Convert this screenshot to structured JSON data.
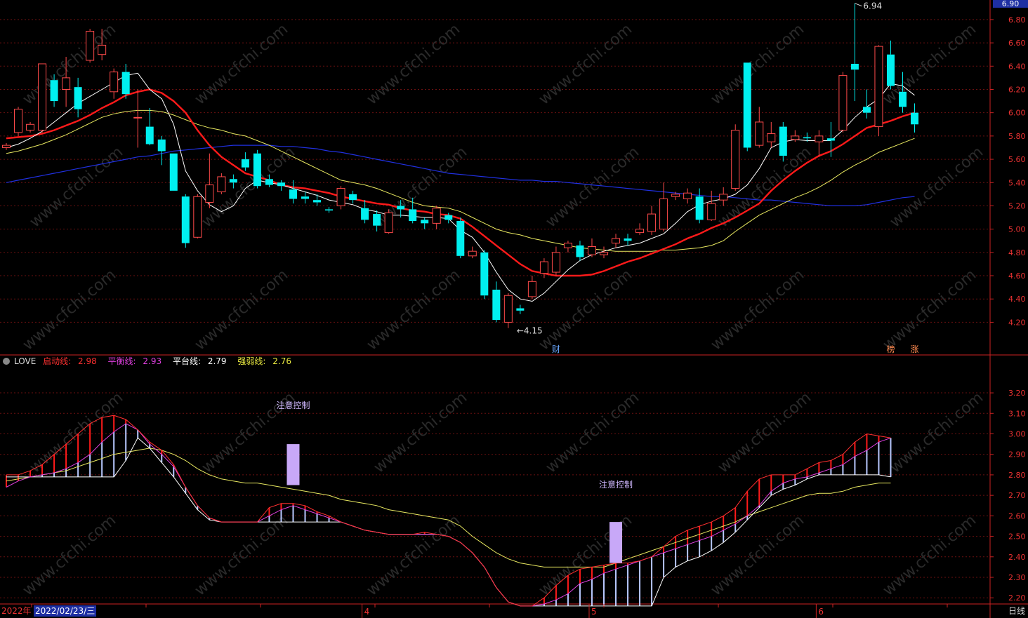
{
  "chart_data": [
    {
      "type": "candlestick",
      "price_axis": {
        "ylim": [
          4.1,
          6.92
        ],
        "ticks": [
          "6.80",
          "6.60",
          "6.40",
          "6.20",
          "6.00",
          "5.80",
          "5.60",
          "5.40",
          "5.20",
          "5.00",
          "4.80",
          "4.60",
          "4.40",
          "4.20"
        ]
      },
      "current_price_tag": "6.90",
      "high_annotation": "6.94",
      "low_annotation": "4.15",
      "markers": [
        {
          "label": "财",
          "index": 46
        },
        {
          "label": "榜",
          "index": 74
        },
        {
          "label": "涨",
          "index": 76
        }
      ],
      "candles": [
        [
          5.7,
          5.72,
          5.68,
          5.74
        ],
        [
          5.83,
          6.03,
          5.8,
          6.05
        ],
        [
          5.85,
          5.9,
          5.83,
          5.92
        ],
        [
          5.85,
          6.42,
          5.83,
          6.42
        ],
        [
          6.28,
          6.1,
          6.05,
          6.33
        ],
        [
          6.2,
          6.3,
          6.05,
          6.48
        ],
        [
          6.22,
          6.03,
          5.96,
          6.3
        ],
        [
          6.45,
          6.7,
          6.43,
          6.72
        ],
        [
          6.5,
          6.58,
          6.45,
          6.72
        ],
        [
          6.18,
          6.35,
          6.12,
          6.38
        ],
        [
          6.35,
          6.16,
          6.12,
          6.42
        ],
        [
          5.96,
          5.96,
          5.7,
          6.2
        ],
        [
          5.88,
          5.73,
          5.72,
          6.04
        ],
        [
          5.77,
          5.67,
          5.55,
          5.8
        ],
        [
          5.65,
          5.33,
          5.33,
          5.65
        ],
        [
          5.28,
          4.88,
          4.84,
          5.3
        ],
        [
          4.93,
          5.28,
          4.92,
          5.3
        ],
        [
          5.23,
          5.38,
          5.18,
          5.65
        ],
        [
          5.32,
          5.45,
          5.3,
          5.48
        ],
        [
          5.43,
          5.4,
          5.35,
          5.47
        ],
        [
          5.6,
          5.53,
          5.5,
          5.66
        ],
        [
          5.65,
          5.37,
          5.35,
          5.68
        ],
        [
          5.43,
          5.38,
          5.36,
          5.47
        ],
        [
          5.4,
          5.37,
          5.33,
          5.42
        ],
        [
          5.34,
          5.26,
          5.22,
          5.42
        ],
        [
          5.28,
          5.26,
          5.22,
          5.32
        ],
        [
          5.25,
          5.23,
          5.2,
          5.3
        ],
        [
          5.17,
          5.16,
          5.14,
          5.19
        ],
        [
          5.2,
          5.35,
          5.17,
          5.37
        ],
        [
          5.3,
          5.25,
          5.22,
          5.33
        ],
        [
          5.18,
          5.08,
          5.05,
          5.25
        ],
        [
          5.13,
          5.03,
          4.98,
          5.16
        ],
        [
          4.97,
          5.14,
          4.96,
          5.17
        ],
        [
          5.2,
          5.17,
          5.1,
          5.25
        ],
        [
          5.17,
          5.07,
          5.05,
          5.27
        ],
        [
          5.08,
          5.05,
          5.0,
          5.1
        ],
        [
          5.05,
          5.18,
          5.0,
          5.2
        ],
        [
          5.12,
          5.08,
          5.05,
          5.14
        ],
        [
          5.07,
          4.77,
          4.75,
          5.1
        ],
        [
          4.77,
          4.81,
          4.75,
          4.85
        ],
        [
          4.8,
          4.43,
          4.4,
          4.82
        ],
        [
          4.48,
          4.22,
          4.2,
          4.55
        ],
        [
          4.2,
          4.43,
          4.15,
          4.45
        ],
        [
          4.32,
          4.3,
          4.27,
          4.35
        ],
        [
          4.42,
          4.55,
          4.4,
          4.6
        ],
        [
          4.62,
          4.72,
          4.58,
          4.75
        ],
        [
          4.63,
          4.8,
          4.6,
          4.85
        ],
        [
          4.84,
          4.88,
          4.8,
          4.9
        ],
        [
          4.86,
          4.76,
          4.73,
          4.9
        ],
        [
          4.78,
          4.85,
          4.76,
          4.92
        ],
        [
          4.78,
          4.8,
          4.75,
          4.85
        ],
        [
          4.88,
          4.92,
          4.84,
          4.96
        ],
        [
          4.92,
          4.9,
          4.86,
          4.96
        ],
        [
          4.97,
          5.0,
          4.95,
          5.05
        ],
        [
          4.98,
          5.13,
          4.95,
          5.2
        ],
        [
          5.0,
          5.26,
          4.98,
          5.4
        ],
        [
          5.28,
          5.3,
          5.25,
          5.32
        ],
        [
          5.26,
          5.31,
          5.22,
          5.35
        ],
        [
          5.28,
          5.08,
          5.05,
          5.35
        ],
        [
          5.08,
          5.22,
          5.07,
          5.33
        ],
        [
          5.25,
          5.3,
          5.2,
          5.36
        ],
        [
          5.35,
          5.85,
          5.33,
          5.9
        ],
        [
          6.43,
          5.7,
          5.67,
          6.43
        ],
        [
          5.72,
          5.92,
          5.7,
          6.05
        ],
        [
          5.75,
          5.82,
          5.7,
          5.92
        ],
        [
          5.88,
          5.63,
          5.58,
          5.92
        ],
        [
          5.77,
          5.8,
          5.75,
          5.85
        ],
        [
          5.79,
          5.78,
          5.75,
          5.83
        ],
        [
          5.75,
          5.8,
          5.62,
          5.85
        ],
        [
          5.78,
          5.76,
          5.62,
          5.92
        ],
        [
          5.85,
          6.32,
          5.83,
          6.35
        ],
        [
          6.42,
          6.37,
          6.1,
          6.94
        ],
        [
          6.05,
          6.0,
          5.95,
          6.2
        ],
        [
          5.88,
          6.57,
          5.8,
          6.58
        ],
        [
          6.5,
          6.23,
          6.2,
          6.62
        ],
        [
          6.18,
          6.05,
          6.0,
          6.35
        ],
        [
          6.0,
          5.9,
          5.83,
          6.08
        ]
      ],
      "ma5": [
        5.7,
        5.73,
        5.78,
        5.84,
        5.92,
        6.0,
        6.08,
        6.14,
        6.2,
        6.26,
        6.32,
        6.34,
        6.2,
        6.12,
        5.9,
        5.5,
        5.33,
        5.21,
        5.15,
        5.2,
        5.35,
        5.42,
        5.4,
        5.38,
        5.35,
        5.32,
        5.29,
        5.25,
        5.23,
        5.21,
        5.17,
        5.15,
        5.12,
        5.12,
        5.11,
        5.1,
        5.1,
        5.09,
        4.99,
        4.93,
        4.8,
        4.63,
        4.48,
        4.4,
        4.38,
        4.45,
        4.55,
        4.65,
        4.73,
        4.78,
        4.81,
        4.84,
        4.86,
        4.88,
        4.92,
        4.96,
        5.05,
        5.15,
        5.21,
        5.24,
        5.26,
        5.3,
        5.38,
        5.52,
        5.7,
        5.75,
        5.77,
        5.76,
        5.76,
        5.76,
        5.85,
        5.96,
        6.05,
        6.12,
        6.25,
        6.23,
        6.15
      ],
      "ma10": [
        5.78,
        5.79,
        5.8,
        5.82,
        5.85,
        5.89,
        5.93,
        5.98,
        6.04,
        6.09,
        6.15,
        6.18,
        6.2,
        6.17,
        6.1,
        6.0,
        5.85,
        5.72,
        5.62,
        5.55,
        5.48,
        5.45,
        5.42,
        5.38,
        5.36,
        5.35,
        5.33,
        5.31,
        5.28,
        5.26,
        5.24,
        5.22,
        5.21,
        5.18,
        5.16,
        5.15,
        5.13,
        5.12,
        5.09,
        5.02,
        4.94,
        4.86,
        4.78,
        4.7,
        4.64,
        4.62,
        4.6,
        4.6,
        4.6,
        4.61,
        4.64,
        4.68,
        4.72,
        4.75,
        4.79,
        4.83,
        4.87,
        4.92,
        4.96,
        5.01,
        5.05,
        5.1,
        5.16,
        5.22,
        5.33,
        5.42,
        5.5,
        5.57,
        5.63,
        5.67,
        5.73,
        5.8,
        5.87,
        5.9,
        5.93,
        5.97,
        6.0
      ],
      "ma20": [
        5.65,
        5.67,
        5.7,
        5.73,
        5.77,
        5.81,
        5.86,
        5.91,
        5.96,
        5.99,
        6.01,
        6.02,
        6.02,
        6.01,
        5.98,
        5.94,
        5.9,
        5.87,
        5.85,
        5.82,
        5.8,
        5.76,
        5.72,
        5.67,
        5.62,
        5.57,
        5.52,
        5.47,
        5.42,
        5.4,
        5.38,
        5.35,
        5.31,
        5.27,
        5.23,
        5.2,
        5.19,
        5.18,
        5.15,
        5.1,
        5.05,
        5.0,
        4.97,
        4.95,
        4.92,
        4.9,
        4.88,
        4.86,
        4.84,
        4.83,
        4.82,
        4.81,
        4.81,
        4.81,
        4.81,
        4.82,
        4.82,
        4.83,
        4.84,
        4.86,
        4.9,
        4.98,
        5.05,
        5.12,
        5.17,
        5.22,
        5.27,
        5.31,
        5.36,
        5.42,
        5.49,
        5.55,
        5.6,
        5.66,
        5.7,
        5.74,
        5.78
      ],
      "ma60": [
        5.4,
        5.42,
        5.44,
        5.46,
        5.48,
        5.5,
        5.52,
        5.54,
        5.56,
        5.58,
        5.6,
        5.62,
        5.63,
        5.65,
        5.67,
        5.68,
        5.69,
        5.7,
        5.71,
        5.72,
        5.72,
        5.72,
        5.72,
        5.71,
        5.71,
        5.7,
        5.69,
        5.67,
        5.66,
        5.64,
        5.62,
        5.6,
        5.58,
        5.56,
        5.54,
        5.52,
        5.5,
        5.48,
        5.47,
        5.46,
        5.45,
        5.44,
        5.43,
        5.42,
        5.42,
        5.41,
        5.41,
        5.4,
        5.39,
        5.38,
        5.37,
        5.36,
        5.35,
        5.34,
        5.33,
        5.32,
        5.31,
        5.3,
        5.29,
        5.28,
        5.28,
        5.27,
        5.26,
        5.25,
        5.25,
        5.24,
        5.23,
        5.22,
        5.21,
        5.2,
        5.2,
        5.2,
        5.21,
        5.23,
        5.25,
        5.27,
        5.28
      ]
    },
    {
      "type": "line",
      "indicator_name": "LOVE",
      "legend": [
        {
          "label": "启动线:",
          "value": "2.98",
          "color": "#ff3030"
        },
        {
          "label": "平衡线:",
          "value": "2.93",
          "color": "#e040e0"
        },
        {
          "label": "平台线:",
          "value": "2.79",
          "color": "#ffffff"
        },
        {
          "label": "强弱线:",
          "value": "2.76",
          "color": "#e8e840"
        }
      ],
      "axis": {
        "ylim": [
          2.17,
          3.32
        ],
        "ticks": [
          "3.20",
          "3.10",
          "3.00",
          "2.90",
          "2.80",
          "2.70",
          "2.60",
          "2.50",
          "2.40",
          "2.30",
          "2.20"
        ]
      },
      "annotations": [
        {
          "text": "注意控制",
          "index": 24
        },
        {
          "text": "注意控制",
          "index": 51
        }
      ],
      "qidong": [
        2.8,
        2.8,
        2.82,
        2.85,
        2.9,
        2.95,
        3.0,
        3.05,
        3.08,
        3.09,
        3.07,
        3.02,
        2.96,
        2.92,
        2.85,
        2.74,
        2.65,
        2.59,
        2.57,
        2.57,
        2.57,
        2.57,
        2.64,
        2.66,
        2.66,
        2.65,
        2.62,
        2.6,
        2.57,
        2.55,
        2.53,
        2.52,
        2.51,
        2.51,
        2.51,
        2.52,
        2.51,
        2.5,
        2.47,
        2.42,
        2.35,
        2.25,
        2.18,
        2.16,
        2.16,
        2.2,
        2.26,
        2.31,
        2.34,
        2.35,
        2.36,
        2.37,
        2.37,
        2.38,
        2.4,
        2.45,
        2.5,
        2.53,
        2.55,
        2.57,
        2.6,
        2.64,
        2.72,
        2.78,
        2.8,
        2.8,
        2.8,
        2.83,
        2.86,
        2.87,
        2.9,
        2.96,
        3.0,
        2.99,
        2.98
      ],
      "pingheng": [
        2.74,
        2.77,
        2.79,
        2.8,
        2.81,
        2.83,
        2.86,
        2.9,
        2.96,
        3.01,
        3.05,
        3.02,
        2.95,
        2.9,
        2.84,
        2.74,
        2.65,
        2.59,
        2.57,
        2.57,
        2.57,
        2.57,
        2.6,
        2.63,
        2.65,
        2.63,
        2.61,
        2.59,
        2.57,
        2.55,
        2.53,
        2.52,
        2.51,
        2.51,
        2.51,
        2.51,
        2.51,
        2.5,
        2.47,
        2.42,
        2.35,
        2.25,
        2.18,
        2.16,
        2.16,
        2.17,
        2.19,
        2.22,
        2.27,
        2.29,
        2.32,
        2.34,
        2.36,
        2.38,
        2.4,
        2.42,
        2.44,
        2.46,
        2.48,
        2.5,
        2.53,
        2.56,
        2.6,
        2.65,
        2.72,
        2.76,
        2.78,
        2.79,
        2.81,
        2.83,
        2.85,
        2.89,
        2.92,
        2.96,
        2.98
      ],
      "pingtai": [
        2.79,
        2.79,
        2.79,
        2.79,
        2.79,
        2.79,
        2.79,
        2.79,
        2.79,
        2.79,
        2.87,
        2.98,
        2.93,
        2.86,
        2.79,
        2.71,
        2.63,
        2.58,
        2.57,
        2.57,
        2.57,
        2.57,
        2.57,
        2.57,
        2.57,
        2.57,
        2.57,
        2.57,
        2.57,
        2.55,
        2.53,
        2.52,
        2.51,
        2.51,
        2.51,
        2.51,
        2.51,
        2.5,
        2.47,
        2.42,
        2.35,
        2.25,
        2.18,
        2.16,
        2.16,
        2.16,
        2.16,
        2.16,
        2.16,
        2.16,
        2.16,
        2.16,
        2.16,
        2.16,
        2.16,
        2.3,
        2.35,
        2.38,
        2.4,
        2.43,
        2.47,
        2.52,
        2.58,
        2.64,
        2.7,
        2.73,
        2.75,
        2.78,
        2.8,
        2.8,
        2.8,
        2.8,
        2.8,
        2.8,
        2.79
      ],
      "qiangruo": [
        2.77,
        2.78,
        2.79,
        2.8,
        2.81,
        2.82,
        2.84,
        2.86,
        2.88,
        2.9,
        2.91,
        2.92,
        2.93,
        2.92,
        2.9,
        2.87,
        2.83,
        2.8,
        2.78,
        2.77,
        2.76,
        2.76,
        2.75,
        2.74,
        2.73,
        2.72,
        2.71,
        2.7,
        2.68,
        2.67,
        2.66,
        2.65,
        2.63,
        2.62,
        2.61,
        2.6,
        2.59,
        2.58,
        2.55,
        2.5,
        2.46,
        2.42,
        2.39,
        2.37,
        2.36,
        2.35,
        2.35,
        2.35,
        2.35,
        2.35,
        2.35,
        2.37,
        2.39,
        2.41,
        2.43,
        2.45,
        2.47,
        2.49,
        2.51,
        2.53,
        2.55,
        2.57,
        2.6,
        2.62,
        2.64,
        2.66,
        2.68,
        2.7,
        2.71,
        2.71,
        2.72,
        2.74,
        2.75,
        2.76,
        2.76
      ]
    }
  ],
  "x_axis": {
    "year_label": "2022年",
    "cursor_date": "2022/02/23/三",
    "month_labels": [
      {
        "label": "4",
        "index": 30
      },
      {
        "label": "5",
        "index": 49
      },
      {
        "label": "6",
        "index": 68
      }
    ],
    "period": "日线"
  },
  "watermark": "www.cfchi.com"
}
